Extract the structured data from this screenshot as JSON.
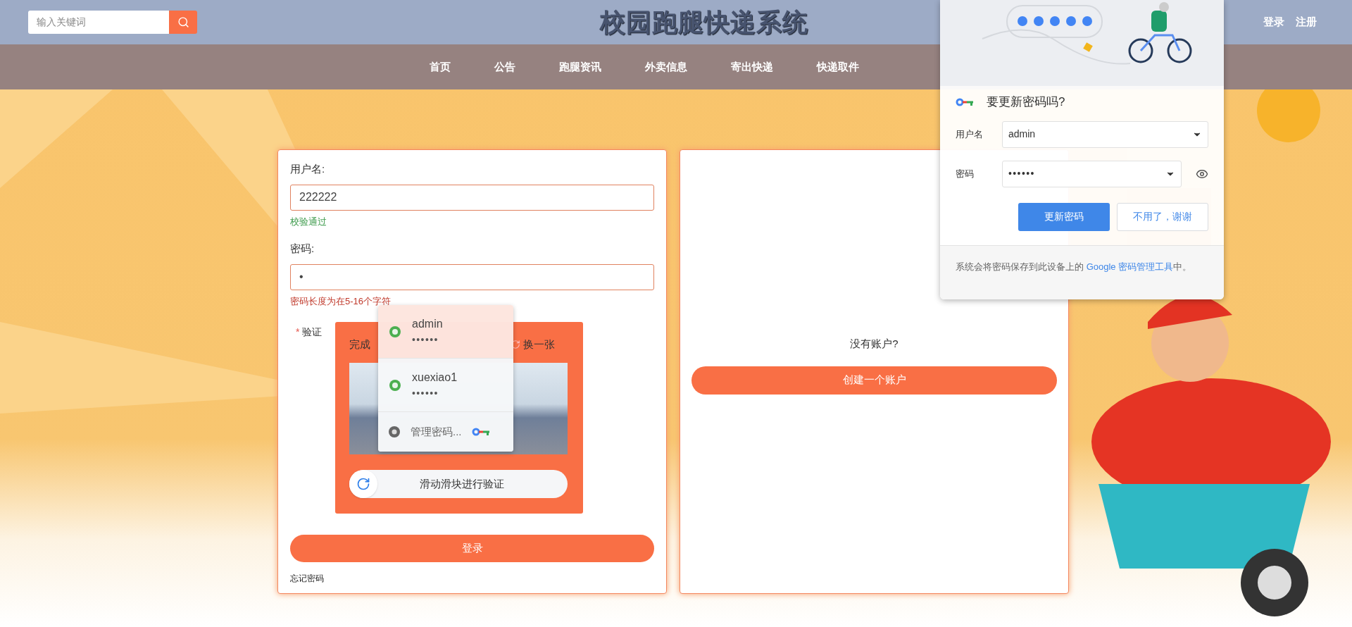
{
  "header": {
    "search": {
      "placeholder": "输入关键词"
    },
    "title": "校园跑腿快递系统",
    "links": [
      "登录",
      "注册"
    ]
  },
  "nav": [
    "首页",
    "公告",
    "跑腿资讯",
    "外卖信息",
    "寄出快递",
    "快递取件"
  ],
  "login_form": {
    "username": {
      "label": "用户名:",
      "value": "222222",
      "message": "校验通过",
      "valid": true
    },
    "password": {
      "label": "密码:",
      "value": "•",
      "message": "密码长度为在5-16个字符",
      "valid": false
    },
    "captcha": {
      "label": "验证",
      "required_mark": "*",
      "title": "完成",
      "refresh": "换一张",
      "slider": "滑动滑块进行验证"
    },
    "submit": "登录",
    "forgot": "忘记密码"
  },
  "register_panel": {
    "prompt": "没有账户?",
    "button": "创建一个账户"
  },
  "autofill": {
    "items": [
      {
        "username": "admin",
        "password": "••••••",
        "selected": true
      },
      {
        "username": "xuexiao1",
        "password": "••••••",
        "selected": false
      }
    ],
    "manage": "管理密码..."
  },
  "password_prompt": {
    "title": "要更新密码吗?",
    "username_label": "用户名",
    "username": "admin",
    "password_label": "密码",
    "password": "••••••",
    "buttons": [
      {
        "label": "更新密码",
        "primary": true
      },
      {
        "label": "不用了，谢谢",
        "primary": false
      }
    ],
    "footer": "系统会将密码保存到此设备上的",
    "footer_link": "Google 密码管理工具",
    "footer_end": "中。"
  }
}
